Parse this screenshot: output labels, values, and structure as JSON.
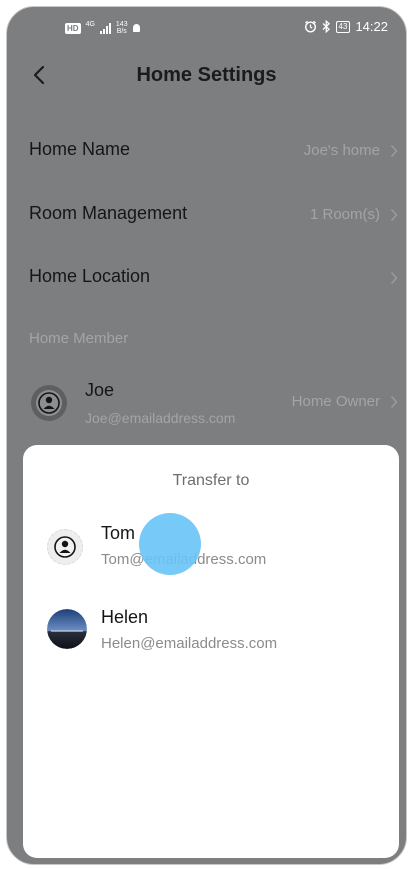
{
  "status_bar": {
    "hd": "HD",
    "network": "4G",
    "speed_value": "143",
    "speed_unit": "B/s",
    "battery": "43",
    "time": "14:22"
  },
  "header": {
    "title": "Home Settings"
  },
  "settings": {
    "home_name": {
      "label": "Home Name",
      "value": "Joe's  home"
    },
    "room_management": {
      "label": "Room Management",
      "value": "1 Room(s)"
    },
    "home_location": {
      "label": "Home Location",
      "value": ""
    }
  },
  "members": {
    "section_label": "Home Member",
    "items": [
      {
        "name": "Joe",
        "email": "Joe@emailaddress.com",
        "role": "Home Owner"
      }
    ]
  },
  "transfer_sheet": {
    "title": "Transfer to",
    "candidates": [
      {
        "name": "Tom",
        "email": "Tom@emailaddress.com",
        "avatar": "default-person-icon"
      },
      {
        "name": "Helen",
        "email": "Helen@emailaddress.com",
        "avatar": "photo-lake-avatar"
      }
    ]
  },
  "colors": {
    "overlay_background": "#7d7e80",
    "sheet_background": "#ffffff",
    "touch_indicator": "#68c4f6"
  }
}
